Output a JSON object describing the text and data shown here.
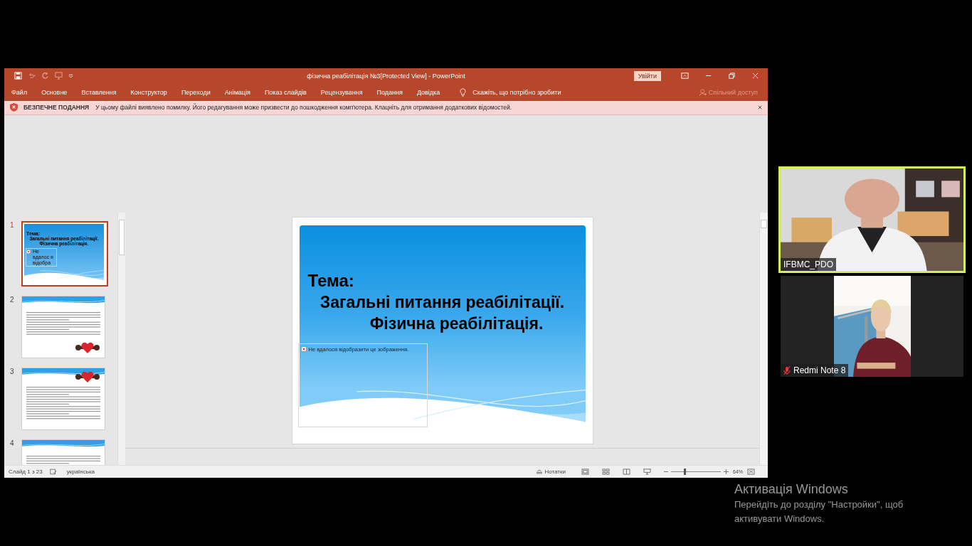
{
  "window": {
    "title": "фізична реабілітація №3[Protected View]  -  PowerPoint",
    "sign_in": "Увійти"
  },
  "menu": [
    {
      "label": "Файл"
    },
    {
      "label": "Основне"
    },
    {
      "label": "Вставлення"
    },
    {
      "label": "Конструктор"
    },
    {
      "label": "Переходи"
    },
    {
      "label": "Анімація"
    },
    {
      "label": "Показ слайдів"
    },
    {
      "label": "Рецензування"
    },
    {
      "label": "Подання"
    },
    {
      "label": "Довідка"
    }
  ],
  "tell_me": "Скажіть, що потрібно зробити",
  "share": "Спільний доступ",
  "protected_view": {
    "title": "БЕЗПЕЧНЕ ПОДАННЯ",
    "message": "У цьому файлі виявлено помилку. Його редагування може призвести до пошкодження комп'ютера. Клацніть для отримання додаткових відомостей."
  },
  "thumbnails": [
    {
      "number": "1",
      "selected": true,
      "kind": "title",
      "heading": "Тема:",
      "lines": [
        "Загальні питання реабілітації.",
        "Фізична реабілітація."
      ],
      "broken_image": "Не вдалос я відобра"
    },
    {
      "number": "2",
      "selected": false,
      "kind": "text_image"
    },
    {
      "number": "3",
      "selected": false,
      "kind": "image_text"
    },
    {
      "number": "4",
      "selected": false,
      "kind": "text"
    }
  ],
  "slide": {
    "heading": "Тема:",
    "lines": [
      "Загальні питання реабілітації.",
      "Фізична реабілітація."
    ],
    "broken_image": "Не вдалося відобразити це зображення."
  },
  "status_bar": {
    "slide_counter": "Слайд 1 з 23",
    "language": "українська",
    "notes": "Нотатки",
    "zoom": {
      "level": 0.27,
      "reading": "64%"
    }
  },
  "participants": [
    {
      "name": "IFBMC_PDO",
      "active_speaker": true,
      "muted": false
    },
    {
      "name": "Redmi Note 8",
      "active_speaker": false,
      "muted": true
    }
  ],
  "activation": {
    "title": "Активація Windows",
    "message": "Перейдіть до розділу \"Настройки\", щоб активувати Windows."
  }
}
